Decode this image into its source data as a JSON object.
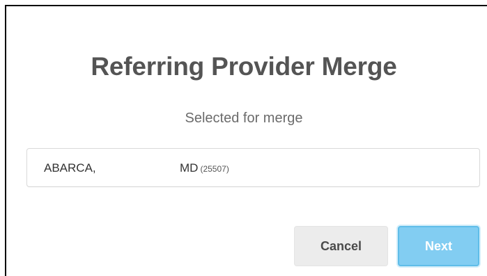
{
  "dialog": {
    "title": "Referring Provider Merge",
    "subtitle": "Selected for merge"
  },
  "selected_provider": {
    "last_name": "ABARCA,",
    "credential": "MD",
    "id": "(25507)"
  },
  "buttons": {
    "cancel_label": "Cancel",
    "next_label": "Next",
    "next_color": "#82cdf2"
  }
}
